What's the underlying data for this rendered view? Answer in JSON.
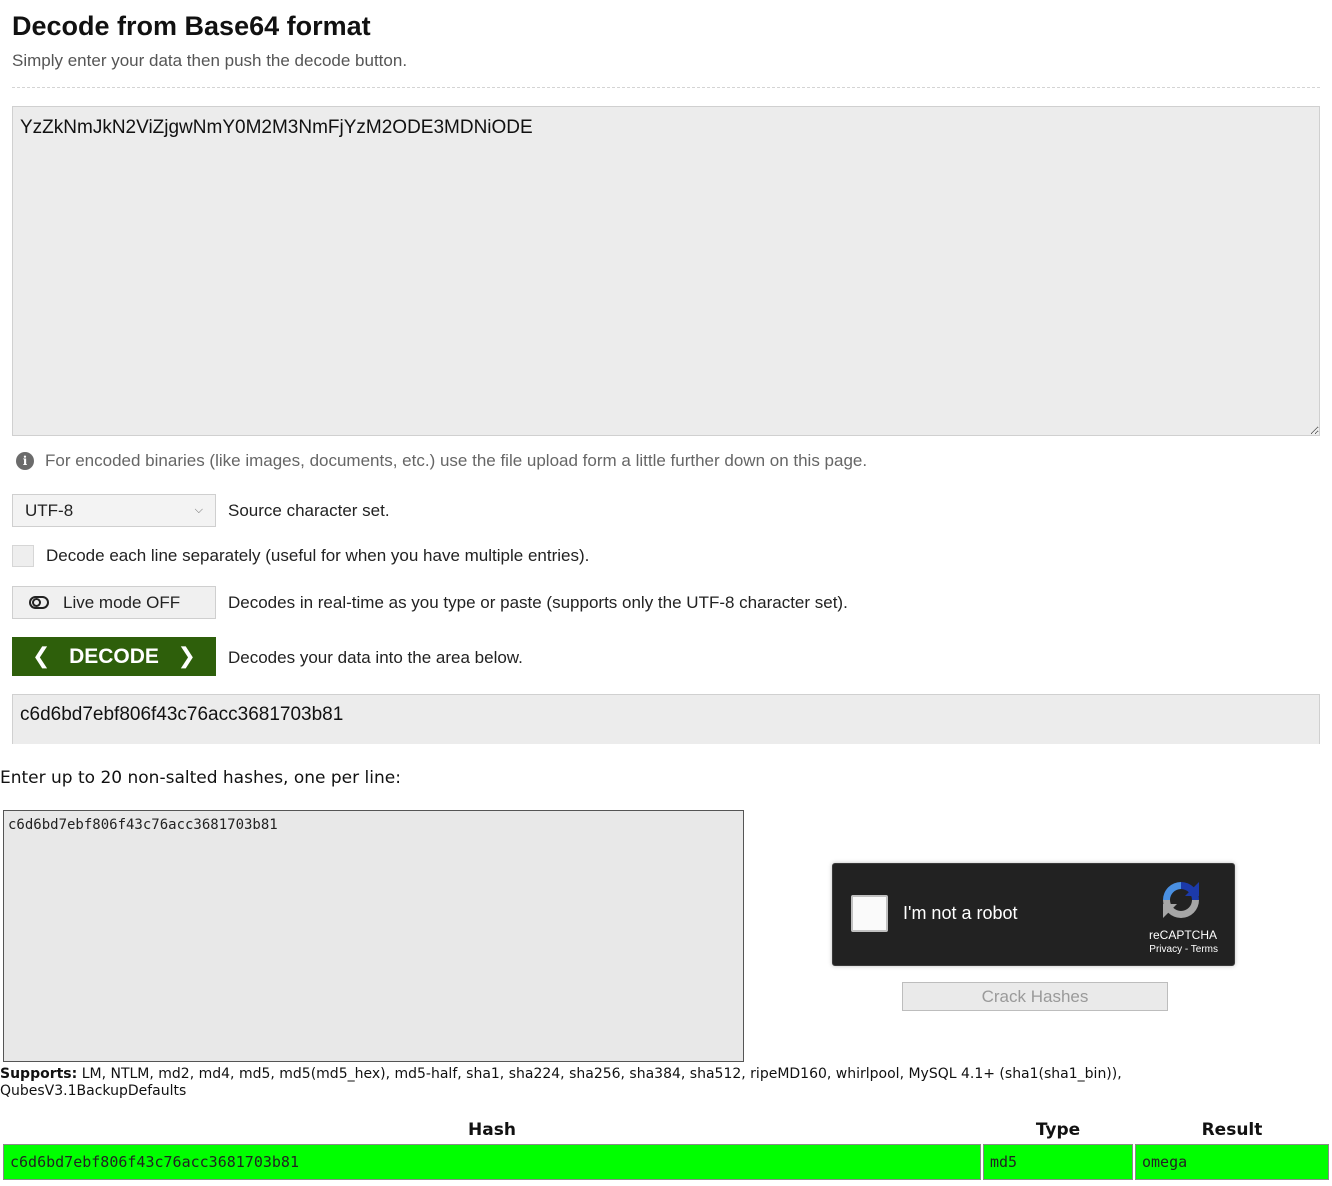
{
  "decoder": {
    "title": "Decode from Base64 format",
    "subtitle": "Simply enter your data then push the decode button.",
    "input_value": "YzZkNmJkN2ViZjgwNmY0M2M3NmFjYzM2ODE3MDNiODE",
    "info_text": "For encoded binaries (like images, documents, etc.) use the file upload form a little further down on this page.",
    "charset": {
      "selected": "UTF-8",
      "label": "Source character set."
    },
    "line_separately": {
      "checked": false,
      "label": "Decode each line separately (useful for when you have multiple entries)."
    },
    "live_mode": {
      "button_label": "Live mode OFF",
      "label": "Decodes in real-time as you type or paste (supports only the UTF-8 character set)."
    },
    "decode": {
      "button_label": "DECODE",
      "label": "Decodes your data into the area below."
    },
    "output_value": "c6d6bd7ebf806f43c76acc3681703b81"
  },
  "hash_cracker": {
    "prompt": "Enter up to 20 non-salted hashes, one per line:",
    "textarea_value": "c6d6bd7ebf806f43c76acc3681703b81",
    "captcha": {
      "label": "I'm not a robot",
      "brand": "reCAPTCHA",
      "links": "Privacy - Terms"
    },
    "crack_button": "Crack Hashes",
    "supports_label": "Supports:",
    "supports_list": " LM, NTLM, md2, md4, md5, md5(md5_hex), md5-half, sha1, sha224, sha256, sha384, sha512, ripeMD160, whirlpool, MySQL 4.1+ (sha1(sha1_bin)), QubesV3.1BackupDefaults",
    "table": {
      "headers": [
        "Hash",
        "Type",
        "Result"
      ],
      "rows": [
        [
          "c6d6bd7ebf806f43c76acc3681703b81",
          "md5",
          "omega"
        ]
      ]
    }
  },
  "colors": {
    "decode_button": "#2e5f0b",
    "result_success": "#00ff00",
    "captcha_bg": "#222222"
  }
}
